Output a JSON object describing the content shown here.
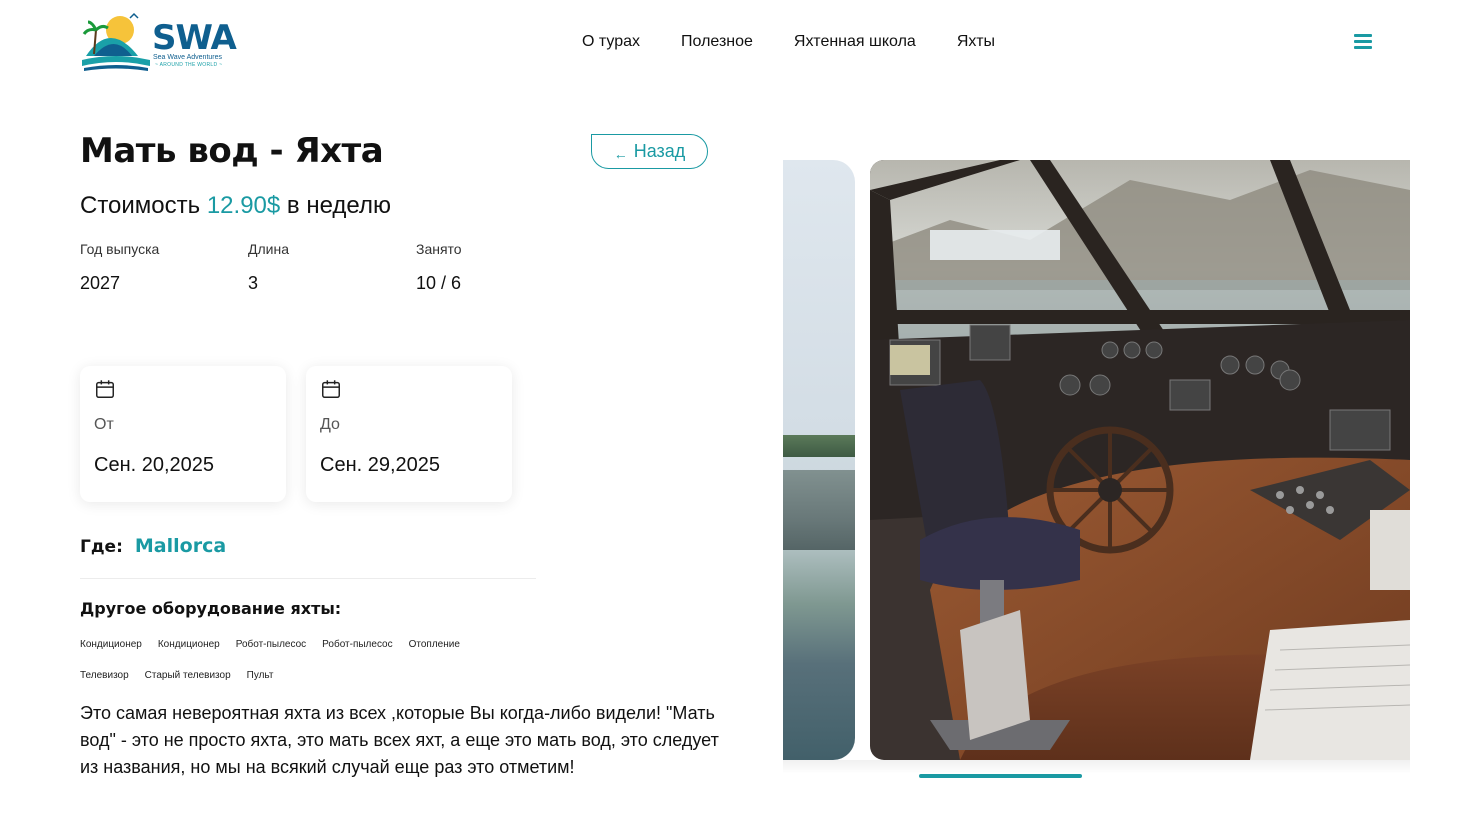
{
  "brand": {
    "name": "SWA",
    "tagline": "Sea Wave Adventures",
    "subtagline": "~ AROUND THE WORLD ~",
    "accent_color": "#1a9aa3",
    "brand_color": "#0f5f8f"
  },
  "nav": {
    "items": [
      "О турах",
      "Полезное",
      "Яхтенная школа",
      "Яхты"
    ],
    "menu_icon": "hamburger-menu-icon"
  },
  "yacht": {
    "title": "Мать вод - Яхта",
    "back_label": "Назад",
    "back_icon": "arrow-left-icon",
    "price_prefix": "Стоимость",
    "price": "12.90$",
    "price_suffix": "в неделю",
    "specs": [
      {
        "label": "Год выпуска",
        "value": "2027"
      },
      {
        "label": "Длина",
        "value": "3"
      },
      {
        "label": "Занято",
        "value": "10 / 6"
      }
    ],
    "dates": {
      "from_label": "От",
      "from_value": "Сен. 20,2025",
      "to_label": "До",
      "to_value": "Сен. 29,2025",
      "icon": "calendar-icon"
    },
    "where_label": "Где:",
    "where_value": "Mallorca",
    "equipment_title": "Другое оборудование яхты:",
    "equipment": [
      "Кондиционер",
      "Кондиционер",
      "Робот-пылесос",
      "Робот-пылесос",
      "Отопление",
      "Телевизор",
      "Старый телевизор",
      "Пульт"
    ],
    "description": "Это самая невероятная яхта из всех ,которые Вы когда-либо видели! \"Мать вод\" - это не просто яхта, это мать всех яхт, а еще это мать вод, это следует из названия, но мы на всякий случай еще раз это отметим!"
  },
  "gallery": {
    "progress": 0.26
  }
}
